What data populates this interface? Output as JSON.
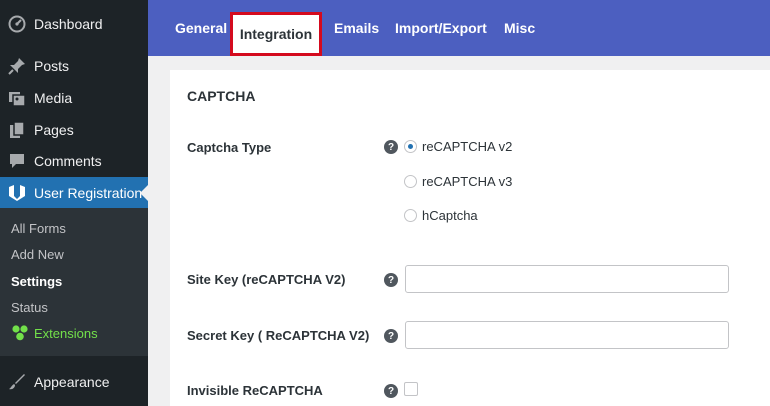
{
  "sidebar": {
    "items": [
      {
        "label": "Dashboard",
        "icon": "dashboard-icon"
      },
      {
        "label": "Posts",
        "icon": "pin-icon"
      },
      {
        "label": "Media",
        "icon": "media-icon"
      },
      {
        "label": "Pages",
        "icon": "pages-icon"
      },
      {
        "label": "Comments",
        "icon": "comment-icon"
      },
      {
        "label": "User Registration",
        "icon": "ur-logo-icon"
      },
      {
        "label": "Appearance",
        "icon": "brush-icon"
      }
    ],
    "submenu": [
      {
        "label": "All Forms"
      },
      {
        "label": "Add New"
      },
      {
        "label": "Settings"
      },
      {
        "label": "Status"
      },
      {
        "label": "Extensions"
      }
    ]
  },
  "tabs": [
    "General",
    "Integration",
    "Emails",
    "Import/Export",
    "Misc"
  ],
  "active_tab": "Integration",
  "section": {
    "title": "CAPTCHA"
  },
  "fields": {
    "captcha_type": {
      "label": "Captcha Type",
      "options": [
        "reCAPTCHA v2",
        "reCAPTCHA v3",
        "hCaptcha"
      ],
      "selected": "reCAPTCHA v2"
    },
    "site_key": {
      "label": "Site Key (reCAPTCHA V2)",
      "value": ""
    },
    "secret_key": {
      "label": "Secret Key ( ReCAPTCHA V2)",
      "value": ""
    },
    "invisible": {
      "label": "Invisible ReCAPTCHA",
      "checked": false
    }
  },
  "help_glyph": "?",
  "colors": {
    "sidebar_bg": "#1d2327",
    "active_menu": "#2271b1",
    "tab_bar": "#4c5fc0",
    "highlight_outline": "#d40a1e",
    "extensions_green": "#72e04a"
  }
}
